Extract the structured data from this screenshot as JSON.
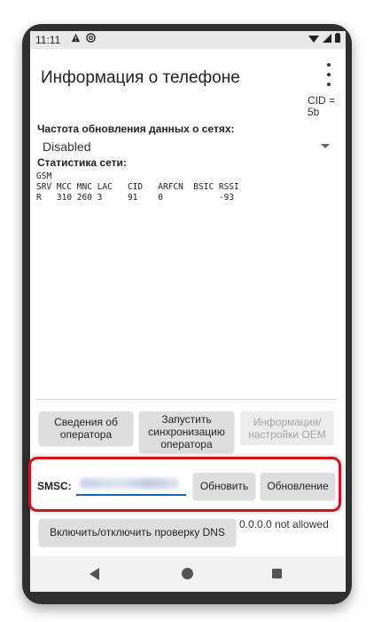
{
  "status_bar": {
    "time": "11:11",
    "icons_left": [
      "warning-icon",
      "at-sign-icon"
    ],
    "icons_right": [
      "wifi-icon",
      "signal-icon",
      "battery-icon"
    ]
  },
  "app_bar": {
    "title": "Информация о телефоне",
    "menu_icon": "more-vert-icon"
  },
  "cid_partial": "CID =\n5b",
  "network_refresh": {
    "label": "Частота обновления данных о сетях:",
    "selected": "Disabled"
  },
  "network_stats": {
    "label": "Статистика сети:",
    "lines": [
      "GSM",
      "SRV MCC MNC LAC   CID   ARFCN  BSIC RSSI",
      "R   310 260 3     91    0           -93"
    ]
  },
  "buttons": {
    "operator_info": "Сведения об оператора",
    "operator_sync": "Запустить синхронизацию оператора",
    "oem_info": "Информация/настройки OEM",
    "update": "Обновить",
    "refresh": "Обновление",
    "dns_toggle": "Включить/отключить проверку DNS"
  },
  "smsc": {
    "label": "SMSC:",
    "value": ""
  },
  "dns_status": "0.0.0.0 not allowed",
  "accent_colors": {
    "field_underline": "#1565c0",
    "highlight_frame": "#d0141d"
  }
}
